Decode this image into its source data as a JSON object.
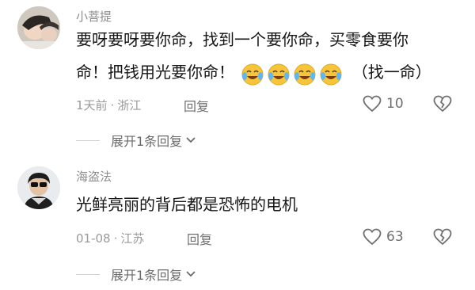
{
  "comments": [
    {
      "username": "小菩提",
      "line1": "要呀要呀要你命，找到一个要你命，买零食要你",
      "line2_pre": "命！把钱用光要你命！",
      "line2_post": "（找一命）",
      "emoji_count": 4,
      "emoji_icon": "laugh-cry-emoji",
      "time": "1天前",
      "location": "浙江",
      "reply_label": "回复",
      "likes": "10",
      "expand_label": "展开1条回复"
    },
    {
      "username": "海盗法",
      "line1": "光鲜亮丽的背后都是恐怖的电机",
      "time": "01-08",
      "location": "江苏",
      "reply_label": "回复",
      "likes": "63",
      "expand_label": "展开1条回复"
    }
  ],
  "separator": "·"
}
